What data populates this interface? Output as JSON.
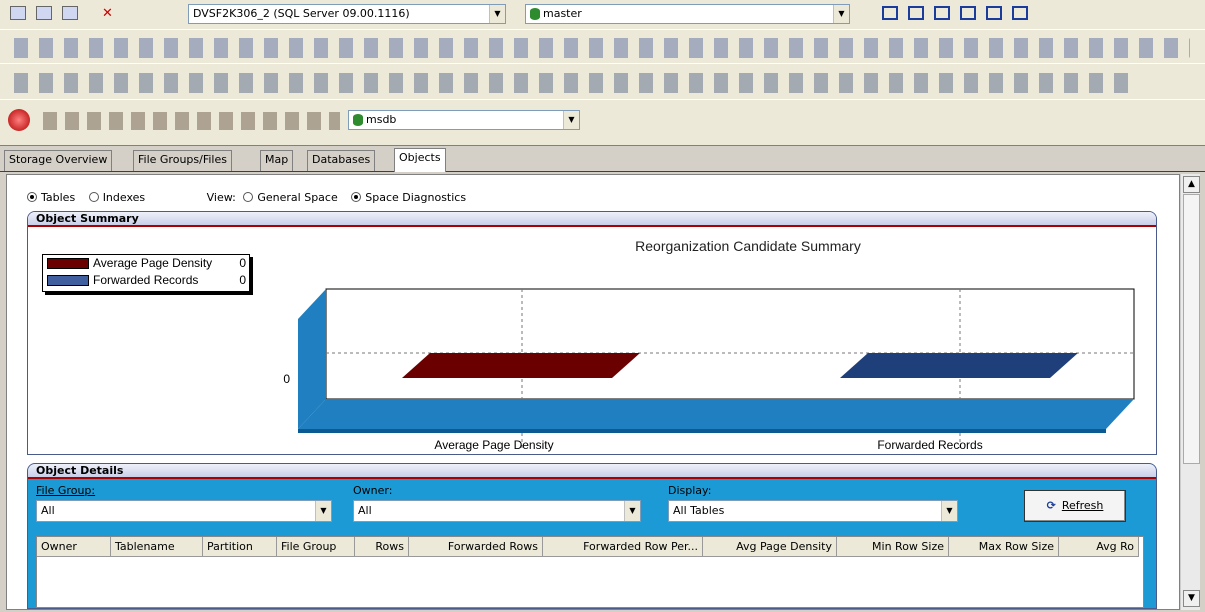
{
  "toolbar1": {
    "server_combo": "DVSF2K306_2 (SQL Server 09.00.1116)",
    "db_combo": "master"
  },
  "toolbar4": {
    "db_combo": "msdb"
  },
  "tabs": [
    "Storage Overview",
    "File Groups/Files",
    "Map",
    "Databases",
    "Objects"
  ],
  "filters": {
    "tables": "Tables",
    "indexes": "Indexes",
    "view_label": "View:",
    "general_space": "General Space",
    "space_diagnostics": "Space Diagnostics"
  },
  "summary": {
    "header": "Object Summary"
  },
  "chart_data": {
    "type": "bar",
    "title": "Reorganization Candidate Summary",
    "categories": [
      "Average Page Density",
      "Forwarded Records"
    ],
    "series": [
      {
        "name": "Average Page Density",
        "values": [
          0,
          null
        ],
        "color": "#6b0000"
      },
      {
        "name": "Forwarded Records",
        "values": [
          null,
          0
        ],
        "color": "#1f3f7a"
      }
    ],
    "legend": [
      {
        "label": "Average Page Density",
        "value": "0"
      },
      {
        "label": "Forwarded Records",
        "value": "0"
      }
    ],
    "ytick": "0",
    "legend_position": "top-left"
  },
  "details": {
    "header": "Object Details",
    "file_group_label": "File Group:",
    "file_group_value": "All",
    "owner_label": "Owner:",
    "owner_value": "All",
    "display_label": "Display:",
    "display_value": "All Tables",
    "refresh_label": "Refresh",
    "columns": [
      "Owner",
      "Tablename",
      "Partition",
      "File Group",
      "Rows",
      "Forwarded Rows",
      "Forwarded Row Per...",
      "Avg Page Density",
      "Min Row Size",
      "Max Row Size",
      "Avg Ro"
    ]
  }
}
